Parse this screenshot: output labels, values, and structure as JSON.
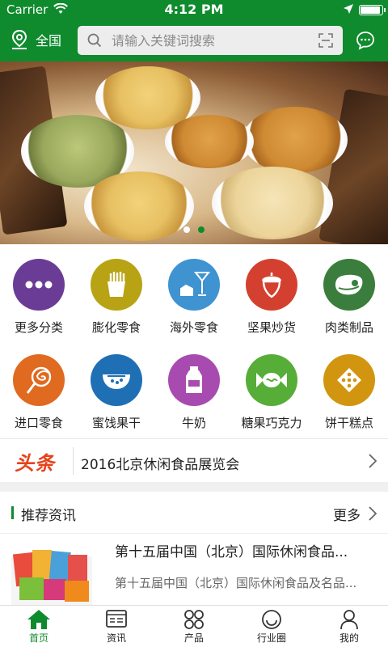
{
  "status_bar": {
    "carrier": "Carrier",
    "time": "4:12 PM",
    "battery_level": 0.95
  },
  "nav": {
    "region": "全国",
    "search_placeholder": "请输入关键词搜索"
  },
  "banner": {
    "slide_count": 2,
    "active_slide": 2
  },
  "categories": [
    {
      "label": "更多分类",
      "icon": "more-dots-icon",
      "color": "#6a3c96"
    },
    {
      "label": "膨化零食",
      "icon": "fries-icon",
      "color": "#b8a314"
    },
    {
      "label": "海外零食",
      "icon": "cocktail-icon",
      "color": "#3f93d1"
    },
    {
      "label": "坚果炒货",
      "icon": "acorn-icon",
      "color": "#d4402f"
    },
    {
      "label": "肉类制品",
      "icon": "steak-icon",
      "color": "#3a7d3c"
    },
    {
      "label": "进口零食",
      "icon": "lollipop-icon",
      "color": "#e06a1f"
    },
    {
      "label": "蜜饯果干",
      "icon": "bowl-icon",
      "color": "#1f6fb5"
    },
    {
      "label": "牛奶",
      "icon": "milk-icon",
      "color": "#a84bb0"
    },
    {
      "label": "糖果巧克力",
      "icon": "candy-icon",
      "color": "#56ad38"
    },
    {
      "label": "饼干糕点",
      "icon": "biscuit-icon",
      "color": "#d1950f"
    }
  ],
  "headline": {
    "tag": "头条",
    "text": "2016北京休闲食品展览会"
  },
  "recommend": {
    "title": "推荐资讯",
    "more": "更多"
  },
  "news": [
    {
      "title": "第十五届中国（北京）国际休闲食品...",
      "summary": "第十五届中国（北京）国际休闲食品及名品..."
    }
  ],
  "tabs": [
    {
      "label": "首页",
      "icon": "home-icon",
      "active": true
    },
    {
      "label": "资讯",
      "icon": "news-icon",
      "active": false
    },
    {
      "label": "产品",
      "icon": "grid-icon",
      "active": false
    },
    {
      "label": "行业圈",
      "icon": "smile-icon",
      "active": false
    },
    {
      "label": "我的",
      "icon": "user-icon",
      "active": false
    }
  ],
  "colors": {
    "brand": "#0f8b2e",
    "headline_tag": "#e8421a"
  }
}
